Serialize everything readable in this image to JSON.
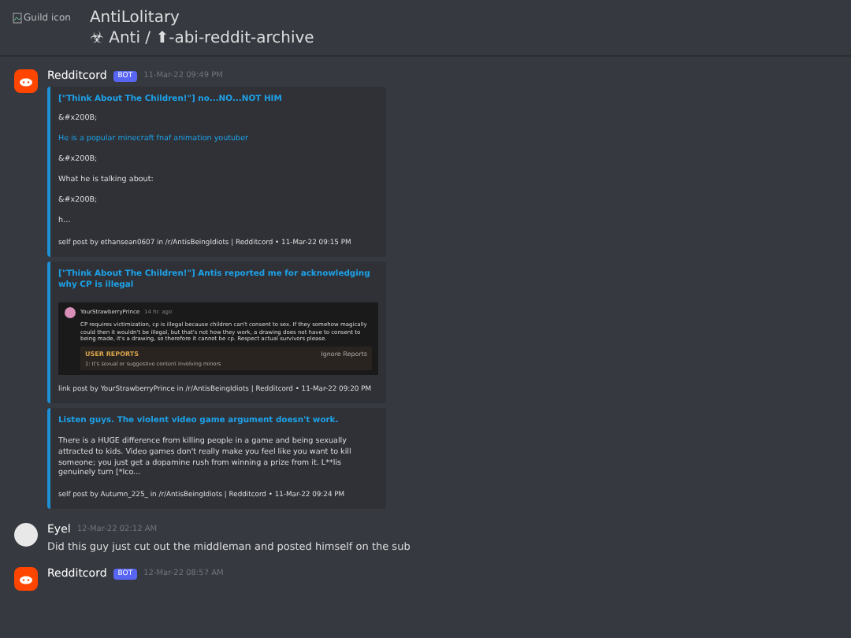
{
  "header": {
    "guild_icon_alt": "Guild icon",
    "guild_name": "AntiLolitary",
    "channel_path": "☣ Anti / ⬆-abi-reddit-archive"
  },
  "messages": [
    {
      "kind": "bot",
      "author": "Redditcord",
      "badge": "BOT",
      "timestamp": "11-Mar-22 09:49 PM",
      "embeds": [
        {
          "title": "[\"Think About The Children!\"] no...NO...NOT HIM",
          "lines": [
            {
              "kind": "text",
              "text": "&#x200B;"
            },
            {
              "kind": "link",
              "text": "He is a popular minecraft fnaf animation youtuber"
            },
            {
              "kind": "text",
              "text": "&#x200B;"
            },
            {
              "kind": "text",
              "text": "What he is talking about:"
            },
            {
              "kind": "text",
              "text": "&#x200B;"
            },
            {
              "kind": "text",
              "text": "h..."
            }
          ],
          "footer": "self post by ethansean0607 in /r/AntisBeingIdiots | Redditcord • 11-Mar-22 09:15 PM"
        },
        {
          "title": "[\"Think About The Children!\"] Antis reported me for acknowledging why CP is illegal",
          "screenshot": {
            "username": "YourStrawberryPrince",
            "age": "14 hr. ago",
            "comment": "CP requires victimization, cp is illegal because children can't consent to sex. If they somehow magically could then it wouldn't be illegal, but that's not how they work, a drawing does not have to consent to being made, it's a drawing, so therefore it cannot be cp. Respect actual survivors please.",
            "reports_label": "USER REPORTS",
            "ignore_label": "Ignore Reports",
            "report": "1: It's sexual or suggestive content involving minors"
          },
          "footer": "link post by YourStrawberryPrince in /r/AntisBeingIdiots | Redditcord • 11-Mar-22 09:20 PM"
        },
        {
          "title": "Listen guys. The violent video game argument doesn't work.",
          "lines": [
            {
              "kind": "text",
              "text": "There is a HUGE difference from killing people in a game and being sexually attracted to kids. Video games don't really make you feel like you want to kill someone; you just get a dopamine rush from winning a prize from it. L**lis genuinely turn [*lco..."
            }
          ],
          "footer": "self post by Autumn_225_ in /r/AntisBeingIdiots | Redditcord • 11-Mar-22 09:24 PM"
        }
      ]
    },
    {
      "kind": "user",
      "author": "Eyel",
      "timestamp": "12-Mar-22 02:12 AM",
      "text": "Did this guy just cut out the middleman and posted himself on the sub"
    },
    {
      "kind": "bot",
      "author": "Redditcord",
      "badge": "BOT",
      "timestamp": "12-Mar-22 08:57 AM"
    }
  ]
}
